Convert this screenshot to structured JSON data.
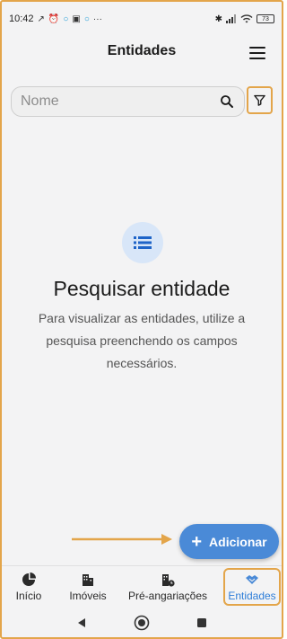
{
  "status_bar": {
    "time": "10:42",
    "more": "···",
    "battery": "73"
  },
  "app_bar": {
    "title": "Entidades"
  },
  "search": {
    "placeholder": "Nome",
    "value": ""
  },
  "empty_state": {
    "title": "Pesquisar entidade",
    "description": "Para visualizar as entidades, utilize a pesquisa preenchendo os campos necessários."
  },
  "fab": {
    "icon": "+",
    "label": "Adicionar"
  },
  "bottom_nav": {
    "items": [
      {
        "label": "Início",
        "icon": "pie-chart-icon"
      },
      {
        "label": "Imóveis",
        "icon": "buildings-icon"
      },
      {
        "label": "Pré-angariações",
        "icon": "building-clock-icon"
      },
      {
        "label": "Entidades",
        "icon": "handshake-icon",
        "active": true
      }
    ]
  },
  "colors": {
    "accent": "#4a8ad7",
    "highlight_annotation": "#e3a54a",
    "active_nav": "#2f7ed8"
  }
}
